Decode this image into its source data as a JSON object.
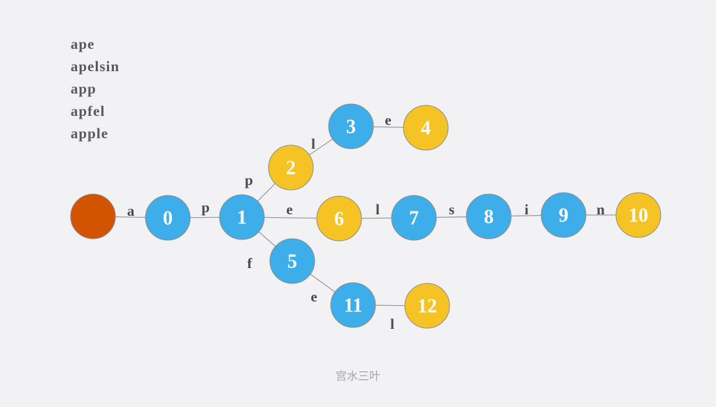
{
  "words": [
    "ape",
    "apelsin",
    "app",
    "apfel",
    "apple"
  ],
  "watermark": "宫水三叶",
  "colors": {
    "root": "#d35400",
    "internal": "#3daee9",
    "end": "#f5c324",
    "edge": "#9e9e9e"
  },
  "nodes": [
    {
      "id": "root",
      "label": "",
      "kind": "root"
    },
    {
      "id": "n0",
      "label": "0",
      "kind": "internal"
    },
    {
      "id": "n1",
      "label": "1",
      "kind": "internal"
    },
    {
      "id": "n2",
      "label": "2",
      "kind": "end"
    },
    {
      "id": "n3",
      "label": "3",
      "kind": "internal"
    },
    {
      "id": "n4",
      "label": "4",
      "kind": "end"
    },
    {
      "id": "n5",
      "label": "5",
      "kind": "internal"
    },
    {
      "id": "n6",
      "label": "6",
      "kind": "end"
    },
    {
      "id": "n7",
      "label": "7",
      "kind": "internal"
    },
    {
      "id": "n8",
      "label": "8",
      "kind": "internal"
    },
    {
      "id": "n9",
      "label": "9",
      "kind": "internal"
    },
    {
      "id": "n10",
      "label": "10",
      "kind": "end"
    },
    {
      "id": "n11",
      "label": "11",
      "kind": "internal"
    },
    {
      "id": "n12",
      "label": "12",
      "kind": "end"
    }
  ],
  "edges": [
    {
      "from": "root",
      "to": "n0",
      "char": "a"
    },
    {
      "from": "n0",
      "to": "n1",
      "char": "p"
    },
    {
      "from": "n1",
      "to": "n2",
      "char": "p"
    },
    {
      "from": "n2",
      "to": "n3",
      "char": "l"
    },
    {
      "from": "n3",
      "to": "n4",
      "char": "e"
    },
    {
      "from": "n1",
      "to": "n6",
      "char": "e"
    },
    {
      "from": "n6",
      "to": "n7",
      "char": "l"
    },
    {
      "from": "n7",
      "to": "n8",
      "char": "s"
    },
    {
      "from": "n8",
      "to": "n9",
      "char": "i"
    },
    {
      "from": "n9",
      "to": "n10",
      "char": "n"
    },
    {
      "from": "n1",
      "to": "n5",
      "char": "f"
    },
    {
      "from": "n5",
      "to": "n11",
      "char": "e"
    },
    {
      "from": "n11",
      "to": "n12",
      "char": "l"
    }
  ]
}
